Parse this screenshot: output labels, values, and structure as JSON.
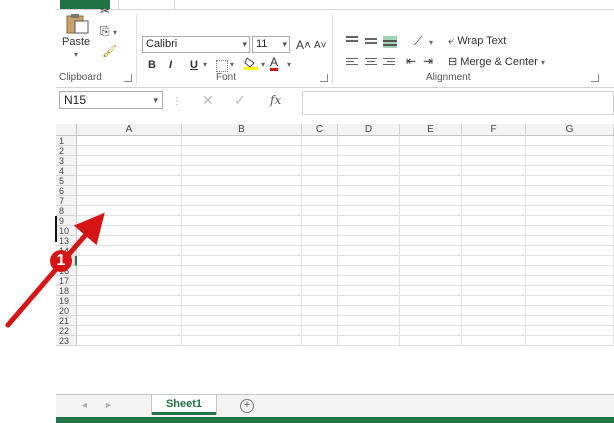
{
  "colors": {
    "accent": "#217346",
    "annotation": "#d71414"
  },
  "ribbon": {
    "clipboard": {
      "paste_label": "Paste",
      "group_label": "Clipboard"
    },
    "font": {
      "font_name": "Calibri",
      "font_size": "11",
      "grow_label": "A˄",
      "shrink_label": "A˅",
      "bold": "B",
      "italic": "I",
      "underline": "U",
      "font_color": "A",
      "group_label": "Font"
    },
    "alignment": {
      "wrap_text": "Wrap Text",
      "merge_center": "Merge & Center",
      "group_label": "Alignment"
    }
  },
  "formula_bar": {
    "name_box": "N15",
    "fx": "fx"
  },
  "sheet": {
    "columns": [
      "A",
      "B",
      "C",
      "D",
      "E",
      "F",
      "G"
    ],
    "rows": [
      "1",
      "2",
      "3",
      "4",
      "5",
      "6",
      "7",
      "8",
      "9",
      "10",
      "13",
      "14",
      "15",
      "16",
      "17",
      "18",
      "19",
      "20",
      "21",
      "22",
      "23"
    ],
    "selected_row": "15"
  },
  "sheet_tabs": {
    "active": "Sheet1",
    "add": "+"
  },
  "annotation": {
    "badge": "1"
  }
}
